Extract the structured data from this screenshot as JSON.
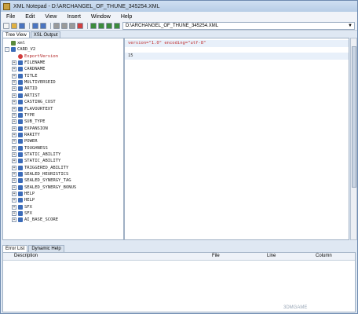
{
  "window": {
    "title": "XML Notepad - D:\\ARCHANGEL_OF_THUNE_345254.XML"
  },
  "menu": [
    "File",
    "Edit",
    "View",
    "Insert",
    "Window",
    "Help"
  ],
  "toolbar": {
    "buttons": [
      "new-icon",
      "open-icon",
      "save-icon",
      "undo-icon",
      "redo-icon",
      "cut-icon",
      "copy-icon",
      "paste-icon",
      "delete-icon",
      "nudge-up-icon",
      "nudge-down-icon",
      "nudge-left-icon",
      "nudge-right-icon",
      "find-icon"
    ],
    "path": "D:\\ARCHANGEL_OF_THUNE_345254.XML"
  },
  "tabs": [
    "Tree View",
    "XSL Output"
  ],
  "tree": [
    {
      "label": "xml",
      "level": 0,
      "kind": "root",
      "expander": "",
      "value": "version=\"1.0\" encoding=\"utf-8\""
    },
    {
      "label": "CARD_V2",
      "level": 0,
      "kind": "elem",
      "expander": "-",
      "value": ""
    },
    {
      "label": "ExportVersion",
      "level": 1,
      "kind": "attr",
      "expander": "",
      "value": "15"
    },
    {
      "label": "FILENAME",
      "level": 1,
      "kind": "elem",
      "expander": "+",
      "value": ""
    },
    {
      "label": "CARDNAME",
      "level": 1,
      "kind": "elem",
      "expander": "+",
      "value": ""
    },
    {
      "label": "TITLE",
      "level": 1,
      "kind": "elem",
      "expander": "+",
      "value": ""
    },
    {
      "label": "MULTIVERSEID",
      "level": 1,
      "kind": "elem",
      "expander": "+",
      "value": ""
    },
    {
      "label": "ARTID",
      "level": 1,
      "kind": "elem",
      "expander": "+",
      "value": ""
    },
    {
      "label": "ARTIST",
      "level": 1,
      "kind": "elem",
      "expander": "+",
      "value": ""
    },
    {
      "label": "CASTING_COST",
      "level": 1,
      "kind": "elem",
      "expander": "+",
      "value": ""
    },
    {
      "label": "FLAVOURTEXT",
      "level": 1,
      "kind": "elem",
      "expander": "+",
      "value": ""
    },
    {
      "label": "TYPE",
      "level": 1,
      "kind": "elem",
      "expander": "+",
      "value": ""
    },
    {
      "label": "SUB_TYPE",
      "level": 1,
      "kind": "elem",
      "expander": "+",
      "value": ""
    },
    {
      "label": "EXPANSION",
      "level": 1,
      "kind": "elem",
      "expander": "+",
      "value": ""
    },
    {
      "label": "RARITY",
      "level": 1,
      "kind": "elem",
      "expander": "+",
      "value": ""
    },
    {
      "label": "POWER",
      "level": 1,
      "kind": "elem",
      "expander": "+",
      "value": ""
    },
    {
      "label": "TOUGHNESS",
      "level": 1,
      "kind": "elem",
      "expander": "+",
      "value": ""
    },
    {
      "label": "STATIC_ABILITY",
      "level": 1,
      "kind": "elem",
      "expander": "+",
      "value": ""
    },
    {
      "label": "STATIC_ABILITY",
      "level": 1,
      "kind": "elem",
      "expander": "+",
      "value": ""
    },
    {
      "label": "TRIGGERED_ABILITY",
      "level": 1,
      "kind": "elem",
      "expander": "+",
      "value": ""
    },
    {
      "label": "SEALED_HEURISTICS",
      "level": 1,
      "kind": "elem",
      "expander": "+",
      "value": ""
    },
    {
      "label": "SEALED_SYNERGY_TAG",
      "level": 1,
      "kind": "elem",
      "expander": "+",
      "value": ""
    },
    {
      "label": "SEALED_SYNERGY_BONUS",
      "level": 1,
      "kind": "elem",
      "expander": "+",
      "value": ""
    },
    {
      "label": "HELP",
      "level": 1,
      "kind": "elem",
      "expander": "+",
      "value": ""
    },
    {
      "label": "HELP",
      "level": 1,
      "kind": "elem",
      "expander": "+",
      "value": ""
    },
    {
      "label": "SFX",
      "level": 1,
      "kind": "elem",
      "expander": "+",
      "value": ""
    },
    {
      "label": "SFX",
      "level": 1,
      "kind": "elem",
      "expander": "+",
      "value": ""
    },
    {
      "label": "AI_BASE_SCORE",
      "level": 1,
      "kind": "elem",
      "expander": "+",
      "value": ""
    }
  ],
  "bottom_tabs": [
    "Error List",
    "Dynamic Help"
  ],
  "error_columns": [
    "Description",
    "File",
    "Line",
    "Column"
  ],
  "watermark": "3DMGAME",
  "colors": {
    "accent": "#3b6bb8",
    "attr": "#b02020",
    "value": "#c03030"
  }
}
